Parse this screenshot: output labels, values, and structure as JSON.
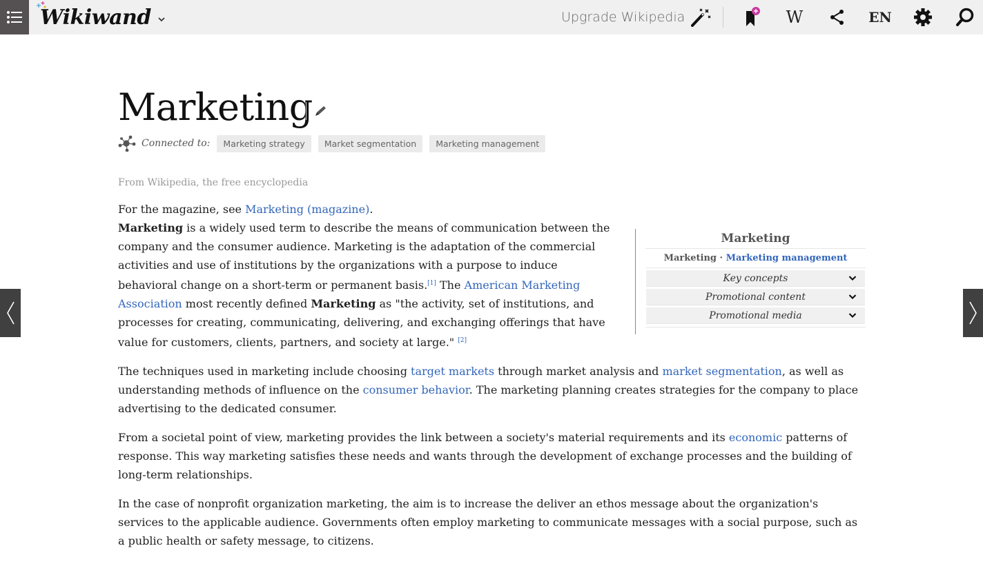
{
  "topbar": {
    "logo": "Wikiwand",
    "upgrade_label": "Upgrade Wikipedia",
    "lang_label": "EN",
    "wiki_label": "W",
    "accent_color": "#c93b9e"
  },
  "article": {
    "title": "Marketing",
    "connected_label": "Connected to:",
    "connected": [
      "Marketing strategy",
      "Market segmentation",
      "Marketing management"
    ],
    "from": "From Wikipedia, the free encyclopedia",
    "hatnote_prefix": "For the magazine, see ",
    "hatnote_link": "Marketing (magazine)",
    "hatnote_suffix": ".",
    "p1": {
      "bold1": "Marketing",
      "t1": " is a widely used term to describe the means of communication between the company and the consumer audience. Marketing is the adaptation of the commercial activities and use of institutions by the organizations with a purpose to induce behavioral change on a short-term or permanent basis.",
      "ref1": "[1]",
      "t2": " The ",
      "link1": "American Marketing Association",
      "t3": " most recently defined ",
      "bold2": "Marketing",
      "t4": " as \"the activity, set of institutions, and processes for creating, communicating, delivering, and exchanging offerings that have value for customers, clients, partners, and society at large.\" ",
      "ref2": "[2]"
    },
    "p2": {
      "t1": "The techniques used in marketing include choosing ",
      "link1": "target markets",
      "t2": " through market analysis and ",
      "link2": "market segmentation",
      "t3": ", as well as understanding methods of influence on the ",
      "link3": "consumer behavior",
      "t4": ". The marketing planning creates strategies for the company to place advertising to the dedicated consumer."
    },
    "p3": {
      "t1": "From a societal point of view, marketing provides the link between a society's material requirements and its ",
      "link1": "economic",
      "t2": " patterns of response. This way marketing satisfies these needs and wants through the development of exchange processes and the building of long-term relationships."
    },
    "p4": "In the case of nonprofit organization marketing, the aim is to increase the deliver an ethos message about the organization's services to the applicable audience. Governments often employ marketing to communicate messages with a social purpose, such as a public health or safety message, to citizens."
  },
  "infobox": {
    "title": "Marketing",
    "sub_plain": "Marketing",
    "sub_sep": " · ",
    "sub_link": "Marketing management",
    "rows": [
      "Key concepts",
      "Promotional content",
      "Promotional media"
    ]
  }
}
